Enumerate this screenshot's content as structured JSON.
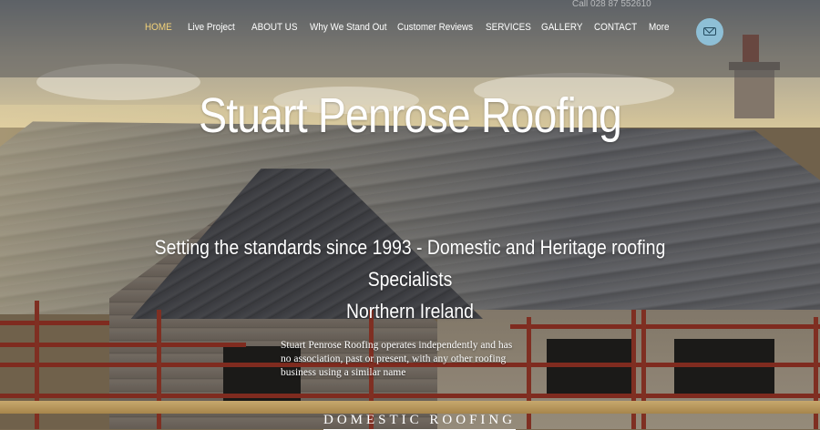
{
  "header": {
    "phone_text": "Call 028 87 552610",
    "nav": [
      {
        "label": "HOME",
        "active": true
      },
      {
        "label": "Live Project",
        "active": false
      },
      {
        "label": "ABOUT US",
        "active": false
      },
      {
        "label": "Why We Stand Out",
        "active": false
      },
      {
        "label": "Customer Reviews",
        "active": false
      },
      {
        "label": "SERVICES",
        "active": false
      },
      {
        "label": "GALLERY",
        "active": false
      },
      {
        "label": "CONTACT",
        "active": false
      },
      {
        "label": "More",
        "active": false
      }
    ],
    "mail_icon": "mail-icon",
    "nav_active_color": "#f3d27a",
    "mail_button_color": "#8ebfd6"
  },
  "hero": {
    "title": "Stuart Penrose Roofing",
    "tagline_line1": "Setting the standards since 1993 - Domestic and Heritage roofing",
    "tagline_line2": "Specialists",
    "tagline_line3": "Northern Ireland",
    "disclaimer": "Stuart Penrose Roofing operates independently and has no association, past or present, with any other roofing business using a similar name",
    "section_link": "DOMESTIC ROOFING",
    "background": "photo of slate roof with red scaffolding"
  }
}
